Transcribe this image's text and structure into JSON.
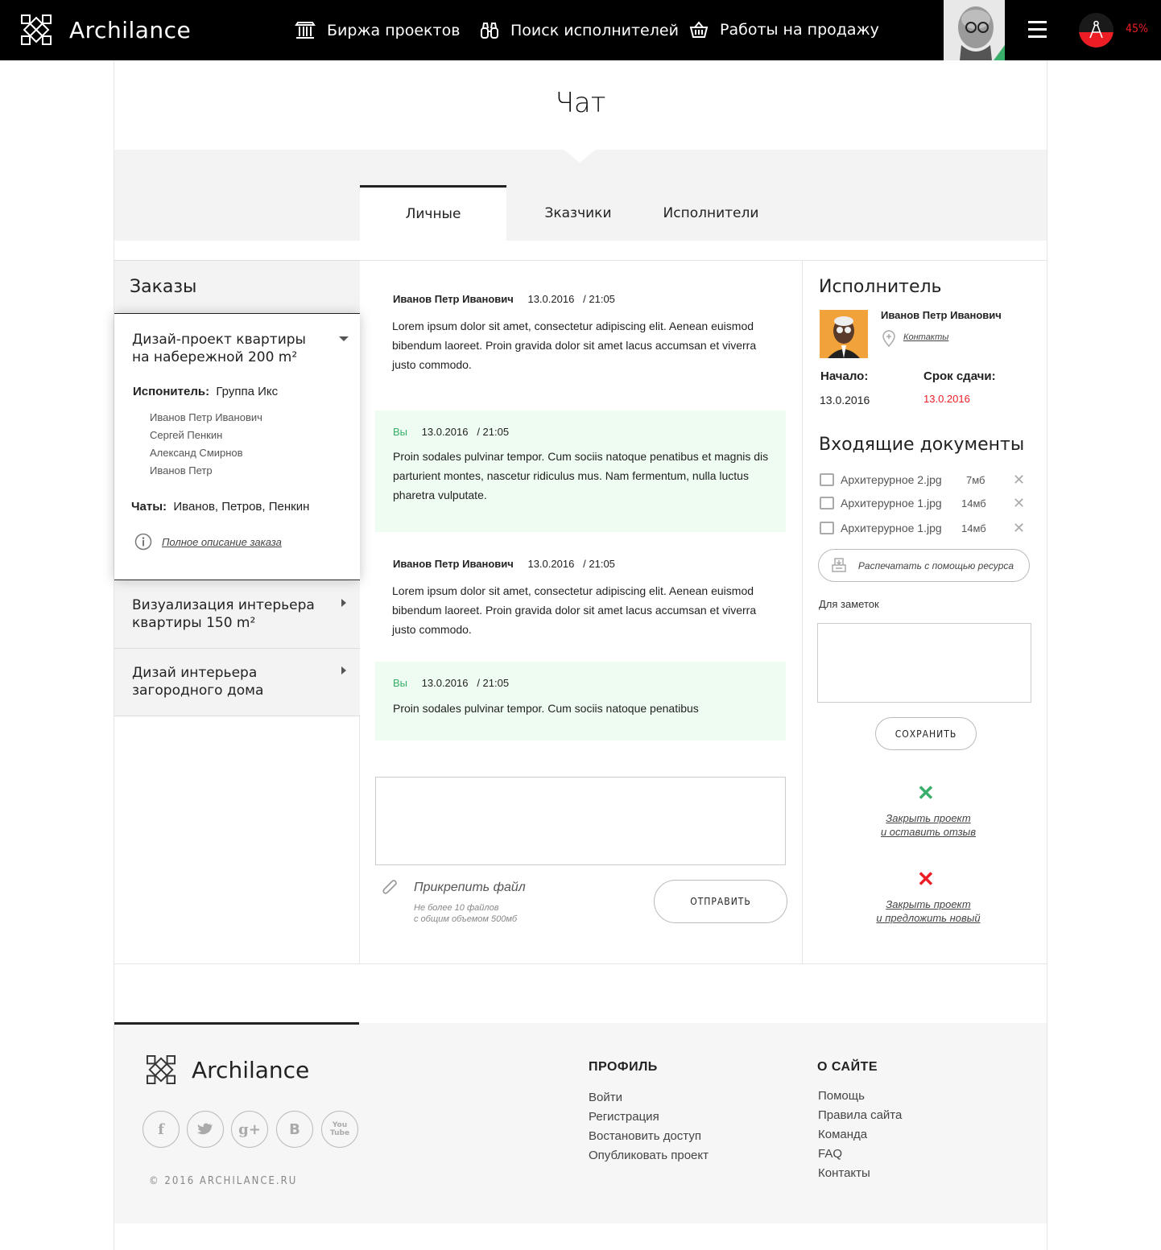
{
  "header": {
    "brand": "Archilance",
    "nav": [
      "Биржа проектов",
      "Поиск исполнителей",
      "Работы на продажу"
    ],
    "progress": {
      "value": 45,
      "label": "45%"
    },
    "accent": "#ec1d24"
  },
  "page_title": "Чат",
  "tabs": [
    "Личные",
    "Зказчики",
    "Исполнители"
  ],
  "orders": {
    "heading": "Заказы",
    "active": {
      "title_line1": "Дизай-проект квартиры",
      "title_line2": "на набережной 200 m²",
      "executor_label": "Испонитель:",
      "executor_value": "Группа Икс",
      "members": [
        "Иванов Петр Иванович",
        "Сергей Пенкин",
        "Александ Смирнов",
        "Иванов Петр"
      ],
      "chats_label": "Чаты:",
      "chats_value": "Иванов, Петров, Пенкин",
      "full_desc": "Полное описание заказа"
    },
    "items": [
      {
        "line1": "Визуализация интерьера",
        "line2": "квартиры 150 m²"
      },
      {
        "line1": "Дизай интерьера",
        "line2": "загородного дома"
      }
    ]
  },
  "messages": [
    {
      "author": "Иванов Петр Иванович",
      "date": "13.0.2016",
      "time": "/  21:05",
      "text": "Lorem ipsum dolor sit amet, consectetur adipiscing elit. Aenean euismod bibendum laoreet. Proin gravida dolor sit amet lacus accumsan et viverra justo commodo."
    },
    {
      "author": "Вы",
      "date": "13.0.2016",
      "time": "/  21:05",
      "text": "Proin sodales pulvinar tempor. Cum sociis natoque penatibus et magnis dis parturient montes, nascetur ridiculus mus. Nam fermentum, nulla luctus pharetra vulputate."
    },
    {
      "author": "Иванов Петр Иванович",
      "date": "13.0.2016",
      "time": "/  21:05",
      "text": "Lorem ipsum dolor sit amet, consectetur adipiscing elit. Aenean euismod bibendum laoreet. Proin gravida dolor sit amet lacus accumsan et viverra justo commodo."
    },
    {
      "author": "Вы",
      "date": "13.0.2016",
      "time": "/  21:05",
      "text": "Proin sodales pulvinar tempor. Cum sociis natoque penatibus"
    }
  ],
  "compose": {
    "attach_label": "Прикрепить файл",
    "attach_hint1": "Не более 10 файлов",
    "attach_hint2": "с общим объемом 500мб",
    "send": "ОТПРАВИТЬ"
  },
  "executor": {
    "heading": "Исполнитель",
    "name": "Иванов Петр Иванович",
    "contacts": "Контакты",
    "start_label": "Начало:",
    "start_value": "13.0.2016",
    "deadline_label": "Срок сдачи:",
    "deadline_value": "13.0.2016"
  },
  "documents": {
    "heading": "Входящие документы",
    "files": [
      {
        "name": "Архитерурное 2.jpg",
        "size": "7мб"
      },
      {
        "name": "Архитерурное 1.jpg",
        "size": "14мб"
      },
      {
        "name": "Архитерурное 1.jpg",
        "size": "14мб"
      }
    ],
    "print": "Распечатать с помощью ресурса"
  },
  "notes": {
    "label": "Для заметок",
    "save": "СОХРАНИТЬ"
  },
  "actions": {
    "close_review_1": "Закрыть проект",
    "close_review_2": "и оставить отзыв",
    "close_new_1": "Закрыть проект",
    "close_new_2": "и предложить новый"
  },
  "footer": {
    "brand": "Archilance",
    "copyright": "© 2016 ARCHILANCE.RU",
    "profile_heading": "ПРОФИЛЬ",
    "profile_links": [
      "Войти",
      "Регистрация",
      "Востановить доступ",
      "Опубликовать проект"
    ],
    "about_heading": "О САЙТЕ",
    "about_links": [
      "Помощь",
      "Правила сайта",
      "Команда",
      "FAQ",
      "Контакты"
    ],
    "social": [
      "facebook-icon",
      "twitter-icon",
      "google-plus-icon",
      "vk-icon",
      "youtube-icon"
    ]
  }
}
